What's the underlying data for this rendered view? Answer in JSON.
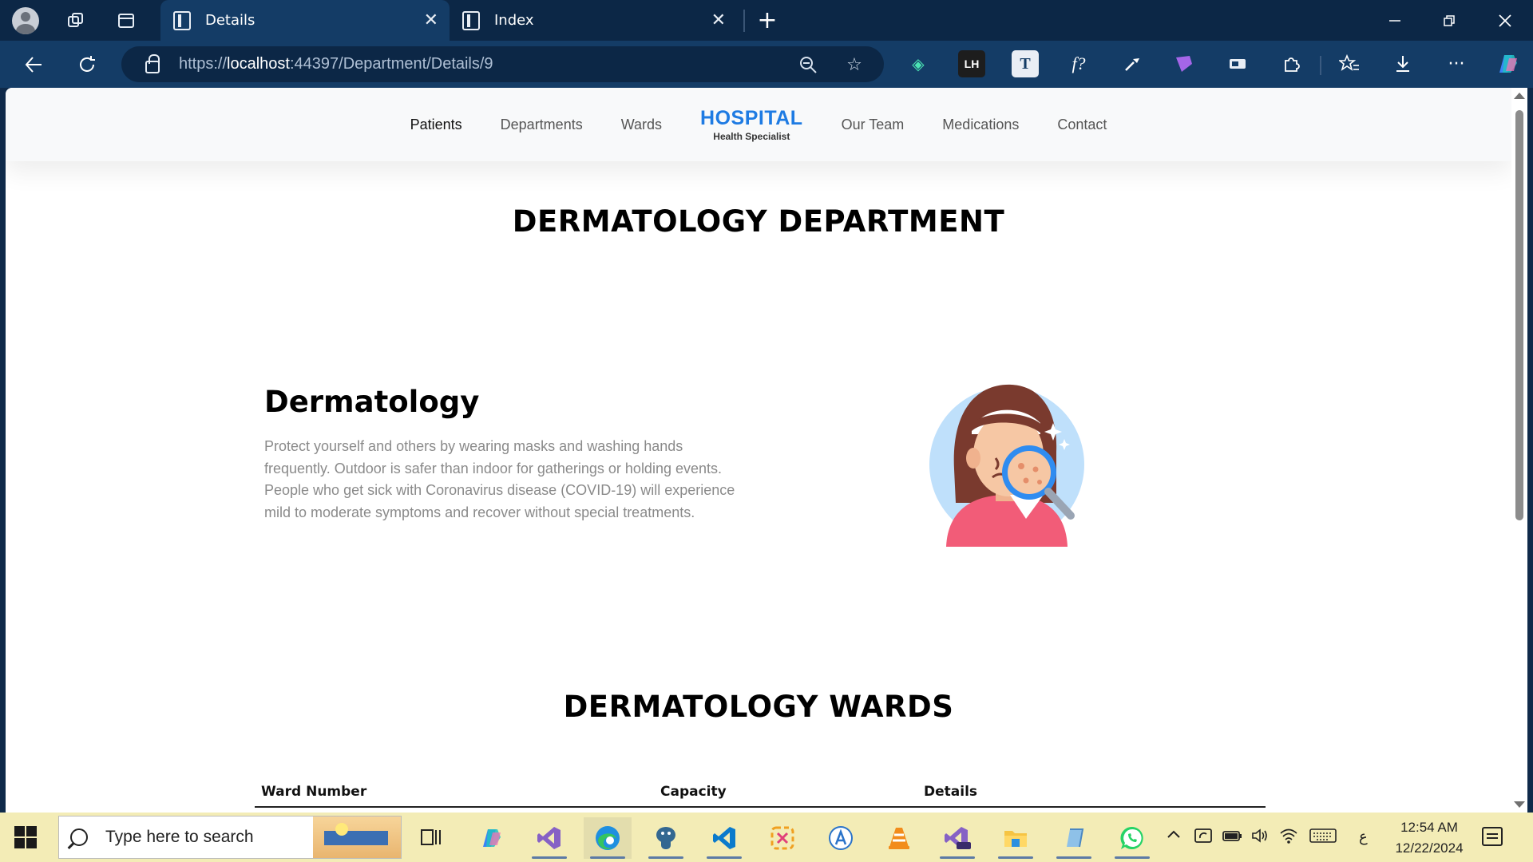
{
  "browser": {
    "tabs": [
      {
        "title": "Details",
        "active": true
      },
      {
        "title": "Index",
        "active": false
      }
    ],
    "url_scheme": "https://",
    "url_host": "localhost",
    "url_rest": ":44397/Department/Details/9",
    "ext_labels": {
      "lh": "LH",
      "t": "T",
      "fx": "f?"
    }
  },
  "site": {
    "nav": {
      "patients": "Patients",
      "departments": "Departments",
      "wards": "Wards",
      "our_team": "Our Team",
      "medications": "Medications",
      "contact": "Contact"
    },
    "brand_title": "HOSPITAL",
    "brand_subtitle": "Health Specialist"
  },
  "page": {
    "heading": "DERMATOLOGY DEPARTMENT",
    "department_name": "Dermatology",
    "department_description": "Protect yourself and others by wearing masks and washing hands frequently. Outdoor is safer than indoor for gatherings or holding events. People who get sick with Coronavirus disease (COVID-19) will experience mild to moderate symptoms and recover without special treatments.",
    "wards_heading": "DERMATOLOGY WARDS",
    "wards_table": {
      "columns": [
        "Ward Number",
        "Capacity",
        "Details"
      ]
    }
  },
  "taskbar": {
    "search_placeholder": "Type here to search",
    "time": "12:54 AM",
    "date": "12/22/2024",
    "language": "ع"
  },
  "colors": {
    "tab_bar": "#0c2746",
    "address_bar": "#143c66",
    "brand": "#1e7be3",
    "taskbar": "#f3ecb6"
  }
}
